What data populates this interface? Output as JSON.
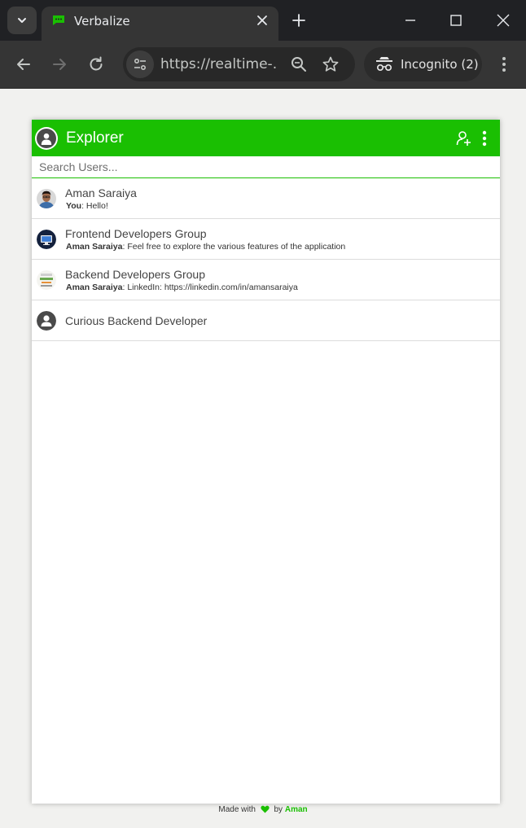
{
  "browser": {
    "tab_title": "Verbalize",
    "url": "https://realtime-...",
    "incognito_label": "Incognito (2)"
  },
  "app": {
    "title": "Explorer",
    "accent_color": "#1abf02",
    "search": {
      "placeholder": "Search Users..."
    },
    "conversations": [
      {
        "name": "Aman Saraiya",
        "sender": "You",
        "message": "Hello!",
        "avatar": "photo-avatar"
      },
      {
        "name": "Frontend Developers Group",
        "sender": "Aman Saraiya",
        "message": "Feel free to explore the various features of the application",
        "avatar": "monitor-group-avatar"
      },
      {
        "name": "Backend Developers Group",
        "sender": "Aman Saraiya",
        "message": "LinkedIn: https://linkedin.com/in/amansaraiya",
        "avatar": "code-group-avatar"
      },
      {
        "name": "Curious Backend Developer",
        "avatar": "default-user-avatar"
      }
    ]
  },
  "footer": {
    "made_with": "Made with",
    "by": "by",
    "author": "Aman"
  }
}
